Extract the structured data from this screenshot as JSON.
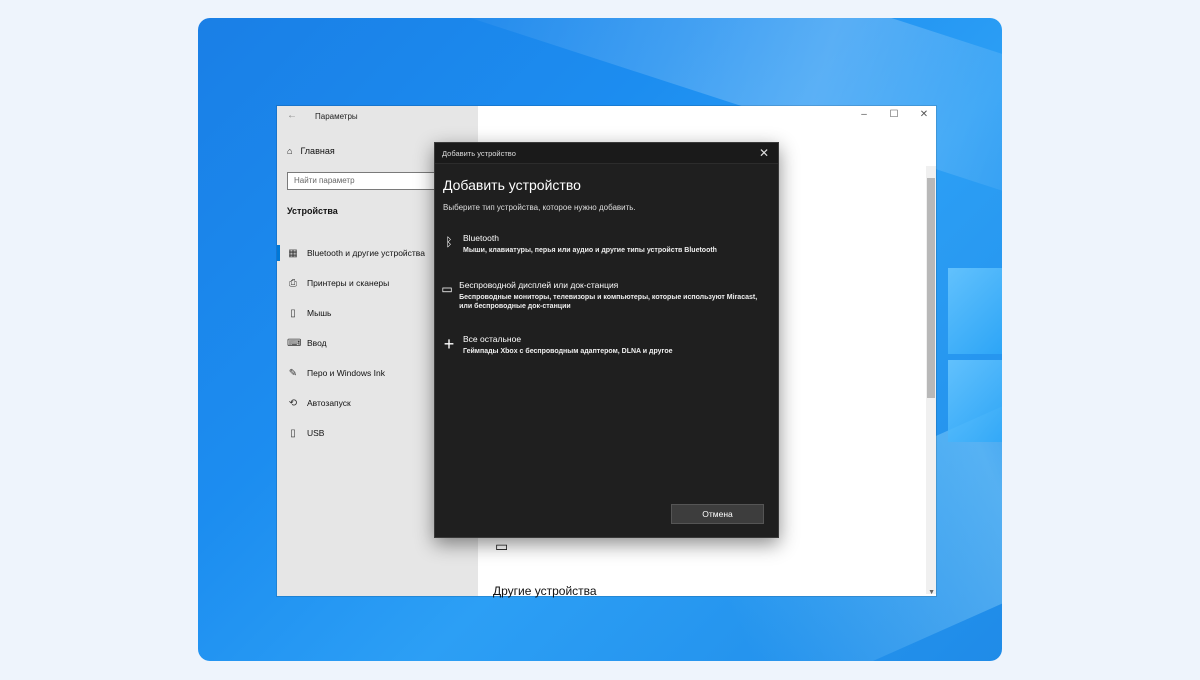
{
  "settings_window": {
    "title": "Параметры",
    "home_label": "Главная",
    "search_placeholder": "Найти параметр",
    "section_title": "Устройства",
    "nav_items": [
      {
        "label": "Bluetooth и другие устройства",
        "icon": "devices-icon",
        "active": true
      },
      {
        "label": "Принтеры и сканеры",
        "icon": "printer-icon",
        "active": false
      },
      {
        "label": "Мышь",
        "icon": "mouse-icon",
        "active": false
      },
      {
        "label": "Ввод",
        "icon": "keyboard-icon",
        "active": false
      },
      {
        "label": "Перо и Windows Ink",
        "icon": "pen-icon",
        "active": false
      },
      {
        "label": "Автозапуск",
        "icon": "autoplay-icon",
        "active": false
      },
      {
        "label": "USB",
        "icon": "usb-icon",
        "active": false
      }
    ],
    "other_devices_heading": "Другие устройства"
  },
  "dialog": {
    "titlebar": "Добавить устройство",
    "heading": "Добавить устройство",
    "subtitle": "Выберите тип устройства, которое нужно добавить.",
    "options": [
      {
        "title": "Bluetooth",
        "description": "Мыши, клавиатуры, перья или аудио и другие типы устройств Bluetooth",
        "icon": "bluetooth-icon"
      },
      {
        "title": "Беспроводной дисплей или док-станция",
        "description": "Беспроводные мониторы, телевизоры и компьютеры, которые используют Miracast, или беспроводные док-станции",
        "icon": "monitor-icon"
      },
      {
        "title": "Все остальное",
        "description": "Геймпады Xbox с беспроводным адаптером, DLNA и другое",
        "icon": "plus-icon"
      }
    ],
    "cancel_label": "Отмена"
  },
  "colors": {
    "accent": "#0078d7",
    "dialog_bg": "#1f1f1f",
    "sidebar_bg": "#e6e6e6",
    "desktop_blue": "#1c8df0"
  }
}
